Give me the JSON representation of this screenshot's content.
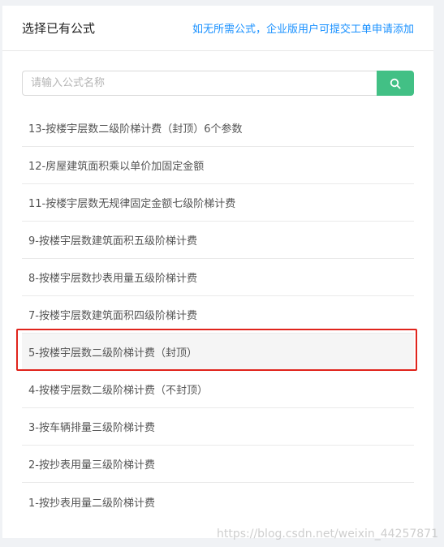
{
  "header": {
    "title": "选择已有公式",
    "hint_link": "如无所需公式，企业版用户可提交工单申请添加"
  },
  "search": {
    "placeholder": "请输入公式名称",
    "button_icon": "search-icon"
  },
  "formulas": [
    "13-按楼宇层数二级阶梯计费（封顶）6个参数",
    "12-房屋建筑面积乘以单价加固定金额",
    "11-按楼宇层数无规律固定金额七级阶梯计费",
    "9-按楼宇层数建筑面积五级阶梯计费",
    "8-按楼宇层数抄表用量五级阶梯计费",
    "7-按楼宇层数建筑面积四级阶梯计费",
    "5-按楼宇层数二级阶梯计费（封顶）",
    "4-按楼宇层数二级阶梯计费（不封顶）",
    "3-按车辆排量三级阶梯计费",
    "2-按抄表用量三级阶梯计费",
    "1-按抄表用量二级阶梯计费"
  ],
  "highlighted_formula": "5-按楼宇层数二级阶梯计费（封顶）",
  "watermark": "https://blog.csdn.net/weixin_44257871",
  "colors": {
    "accent_link": "#1890ff",
    "search_button": "#42c085",
    "highlight_border": "#e0241c"
  }
}
